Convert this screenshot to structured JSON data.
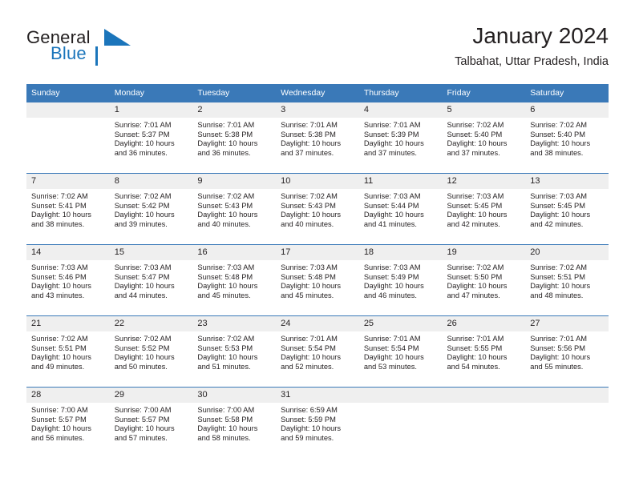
{
  "brand": {
    "word1": "General",
    "word2": "Blue",
    "logo_icon": "blue-triangle-logo"
  },
  "header": {
    "title": "January 2024",
    "subtitle": "Talbahat, Uttar Pradesh, India"
  },
  "colors": {
    "header_blue": "#3a79b8",
    "brand_blue": "#1b75bb",
    "daynum_band": "#efefef",
    "text": "#231f20"
  },
  "weekdays": [
    "Sunday",
    "Monday",
    "Tuesday",
    "Wednesday",
    "Thursday",
    "Friday",
    "Saturday"
  ],
  "weeks": [
    [
      {
        "day": "",
        "sunrise": "",
        "sunset": "",
        "daylight1": "",
        "daylight2": ""
      },
      {
        "day": "1",
        "sunrise": "Sunrise: 7:01 AM",
        "sunset": "Sunset: 5:37 PM",
        "daylight1": "Daylight: 10 hours",
        "daylight2": "and 36 minutes."
      },
      {
        "day": "2",
        "sunrise": "Sunrise: 7:01 AM",
        "sunset": "Sunset: 5:38 PM",
        "daylight1": "Daylight: 10 hours",
        "daylight2": "and 36 minutes."
      },
      {
        "day": "3",
        "sunrise": "Sunrise: 7:01 AM",
        "sunset": "Sunset: 5:38 PM",
        "daylight1": "Daylight: 10 hours",
        "daylight2": "and 37 minutes."
      },
      {
        "day": "4",
        "sunrise": "Sunrise: 7:01 AM",
        "sunset": "Sunset: 5:39 PM",
        "daylight1": "Daylight: 10 hours",
        "daylight2": "and 37 minutes."
      },
      {
        "day": "5",
        "sunrise": "Sunrise: 7:02 AM",
        "sunset": "Sunset: 5:40 PM",
        "daylight1": "Daylight: 10 hours",
        "daylight2": "and 37 minutes."
      },
      {
        "day": "6",
        "sunrise": "Sunrise: 7:02 AM",
        "sunset": "Sunset: 5:40 PM",
        "daylight1": "Daylight: 10 hours",
        "daylight2": "and 38 minutes."
      }
    ],
    [
      {
        "day": "7",
        "sunrise": "Sunrise: 7:02 AM",
        "sunset": "Sunset: 5:41 PM",
        "daylight1": "Daylight: 10 hours",
        "daylight2": "and 38 minutes."
      },
      {
        "day": "8",
        "sunrise": "Sunrise: 7:02 AM",
        "sunset": "Sunset: 5:42 PM",
        "daylight1": "Daylight: 10 hours",
        "daylight2": "and 39 minutes."
      },
      {
        "day": "9",
        "sunrise": "Sunrise: 7:02 AM",
        "sunset": "Sunset: 5:43 PM",
        "daylight1": "Daylight: 10 hours",
        "daylight2": "and 40 minutes."
      },
      {
        "day": "10",
        "sunrise": "Sunrise: 7:02 AM",
        "sunset": "Sunset: 5:43 PM",
        "daylight1": "Daylight: 10 hours",
        "daylight2": "and 40 minutes."
      },
      {
        "day": "11",
        "sunrise": "Sunrise: 7:03 AM",
        "sunset": "Sunset: 5:44 PM",
        "daylight1": "Daylight: 10 hours",
        "daylight2": "and 41 minutes."
      },
      {
        "day": "12",
        "sunrise": "Sunrise: 7:03 AM",
        "sunset": "Sunset: 5:45 PM",
        "daylight1": "Daylight: 10 hours",
        "daylight2": "and 42 minutes."
      },
      {
        "day": "13",
        "sunrise": "Sunrise: 7:03 AM",
        "sunset": "Sunset: 5:45 PM",
        "daylight1": "Daylight: 10 hours",
        "daylight2": "and 42 minutes."
      }
    ],
    [
      {
        "day": "14",
        "sunrise": "Sunrise: 7:03 AM",
        "sunset": "Sunset: 5:46 PM",
        "daylight1": "Daylight: 10 hours",
        "daylight2": "and 43 minutes."
      },
      {
        "day": "15",
        "sunrise": "Sunrise: 7:03 AM",
        "sunset": "Sunset: 5:47 PM",
        "daylight1": "Daylight: 10 hours",
        "daylight2": "and 44 minutes."
      },
      {
        "day": "16",
        "sunrise": "Sunrise: 7:03 AM",
        "sunset": "Sunset: 5:48 PM",
        "daylight1": "Daylight: 10 hours",
        "daylight2": "and 45 minutes."
      },
      {
        "day": "17",
        "sunrise": "Sunrise: 7:03 AM",
        "sunset": "Sunset: 5:48 PM",
        "daylight1": "Daylight: 10 hours",
        "daylight2": "and 45 minutes."
      },
      {
        "day": "18",
        "sunrise": "Sunrise: 7:03 AM",
        "sunset": "Sunset: 5:49 PM",
        "daylight1": "Daylight: 10 hours",
        "daylight2": "and 46 minutes."
      },
      {
        "day": "19",
        "sunrise": "Sunrise: 7:02 AM",
        "sunset": "Sunset: 5:50 PM",
        "daylight1": "Daylight: 10 hours",
        "daylight2": "and 47 minutes."
      },
      {
        "day": "20",
        "sunrise": "Sunrise: 7:02 AM",
        "sunset": "Sunset: 5:51 PM",
        "daylight1": "Daylight: 10 hours",
        "daylight2": "and 48 minutes."
      }
    ],
    [
      {
        "day": "21",
        "sunrise": "Sunrise: 7:02 AM",
        "sunset": "Sunset: 5:51 PM",
        "daylight1": "Daylight: 10 hours",
        "daylight2": "and 49 minutes."
      },
      {
        "day": "22",
        "sunrise": "Sunrise: 7:02 AM",
        "sunset": "Sunset: 5:52 PM",
        "daylight1": "Daylight: 10 hours",
        "daylight2": "and 50 minutes."
      },
      {
        "day": "23",
        "sunrise": "Sunrise: 7:02 AM",
        "sunset": "Sunset: 5:53 PM",
        "daylight1": "Daylight: 10 hours",
        "daylight2": "and 51 minutes."
      },
      {
        "day": "24",
        "sunrise": "Sunrise: 7:01 AM",
        "sunset": "Sunset: 5:54 PM",
        "daylight1": "Daylight: 10 hours",
        "daylight2": "and 52 minutes."
      },
      {
        "day": "25",
        "sunrise": "Sunrise: 7:01 AM",
        "sunset": "Sunset: 5:54 PM",
        "daylight1": "Daylight: 10 hours",
        "daylight2": "and 53 minutes."
      },
      {
        "day": "26",
        "sunrise": "Sunrise: 7:01 AM",
        "sunset": "Sunset: 5:55 PM",
        "daylight1": "Daylight: 10 hours",
        "daylight2": "and 54 minutes."
      },
      {
        "day": "27",
        "sunrise": "Sunrise: 7:01 AM",
        "sunset": "Sunset: 5:56 PM",
        "daylight1": "Daylight: 10 hours",
        "daylight2": "and 55 minutes."
      }
    ],
    [
      {
        "day": "28",
        "sunrise": "Sunrise: 7:00 AM",
        "sunset": "Sunset: 5:57 PM",
        "daylight1": "Daylight: 10 hours",
        "daylight2": "and 56 minutes."
      },
      {
        "day": "29",
        "sunrise": "Sunrise: 7:00 AM",
        "sunset": "Sunset: 5:57 PM",
        "daylight1": "Daylight: 10 hours",
        "daylight2": "and 57 minutes."
      },
      {
        "day": "30",
        "sunrise": "Sunrise: 7:00 AM",
        "sunset": "Sunset: 5:58 PM",
        "daylight1": "Daylight: 10 hours",
        "daylight2": "and 58 minutes."
      },
      {
        "day": "31",
        "sunrise": "Sunrise: 6:59 AM",
        "sunset": "Sunset: 5:59 PM",
        "daylight1": "Daylight: 10 hours",
        "daylight2": "and 59 minutes."
      },
      {
        "day": "",
        "sunrise": "",
        "sunset": "",
        "daylight1": "",
        "daylight2": ""
      },
      {
        "day": "",
        "sunrise": "",
        "sunset": "",
        "daylight1": "",
        "daylight2": ""
      },
      {
        "day": "",
        "sunrise": "",
        "sunset": "",
        "daylight1": "",
        "daylight2": ""
      }
    ]
  ]
}
